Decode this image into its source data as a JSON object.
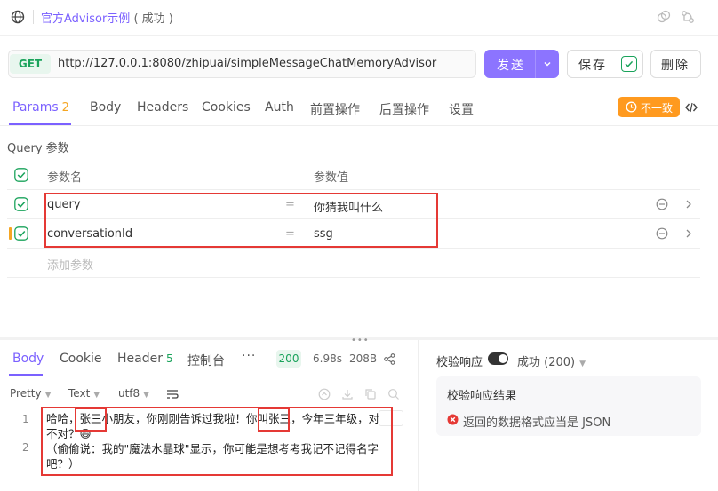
{
  "header": {
    "title": "官方Advisor示例",
    "status": "( 成功 )"
  },
  "request": {
    "method": "GET",
    "url": "http://127.0.0.1:8080/zhipuai/simpleMessageChatMemoryAdvisor",
    "send_label": "发送",
    "save_label": "保存",
    "delete_label": "删除"
  },
  "tabs": [
    {
      "label": "Params",
      "count": "2"
    },
    {
      "label": "Body"
    },
    {
      "label": "Headers"
    },
    {
      "label": "Cookies"
    },
    {
      "label": "Auth"
    },
    {
      "label": "前置操作"
    },
    {
      "label": "后置操作"
    },
    {
      "label": "设置"
    }
  ],
  "mismatch_label": "不一致",
  "query": {
    "title": "Query 参数",
    "col_name": "参数名",
    "col_value": "参数值",
    "rows": [
      {
        "name": "query",
        "value": "你猜我叫什么"
      },
      {
        "name": "conversationId",
        "value": "ssg"
      }
    ],
    "add_placeholder": "添加参数",
    "eq": "="
  },
  "response": {
    "tabs": [
      {
        "label": "Body"
      },
      {
        "label": "Cookie"
      },
      {
        "label": "Header",
        "count": "5"
      },
      {
        "label": "控制台"
      }
    ],
    "more": "···",
    "status_code": "200",
    "time": "6.98s",
    "size": "208B",
    "format": {
      "pretty": "Pretty",
      "text": "Text",
      "encoding": "utf8"
    },
    "lines": [
      "1",
      "2"
    ],
    "body_line1_pre": "哈哈，",
    "body_name1": "张三",
    "body_line1_mid": "小朋友，你刚刚告诉过我啦！你叫",
    "body_name2": "张三",
    "body_line1_post": "，今年三年级，对不对？😄",
    "body_line2": "（偷偷说：我的\"魔法水晶球\"显示，你可能是想考考我记不记得名字吧？）"
  },
  "validation": {
    "label": "校验响应",
    "status": "成功 (200)",
    "card_title": "校验响应结果",
    "error": "返回的数据格式应当是 JSON"
  },
  "colors": {
    "accent": "#7b61ff",
    "success": "#1aa35b",
    "warning": "#ff9a1f",
    "error": "#e53935"
  }
}
